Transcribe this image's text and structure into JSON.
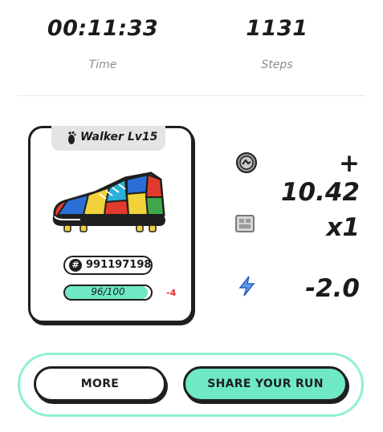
{
  "stats": {
    "time_value": "00:11:33",
    "time_label": "Time",
    "steps_value": "1131",
    "steps_label": "Steps"
  },
  "sneaker": {
    "badge_label": "Walker Lv15",
    "badge_icon": "footprint-icon",
    "id_value": "991197198",
    "durability_text": "96/100",
    "durability_fraction": 0.96,
    "durability_delta": "-4"
  },
  "rewards": {
    "earnings_value": "+ 10.42",
    "earnings_icon": "gst-coin-icon",
    "multiplier_value": "x1",
    "multiplier_icon": "realm-stamp-icon",
    "energy_value": "-2.0",
    "energy_icon": "energy-bolt-icon"
  },
  "actions": {
    "more_label": "MORE",
    "share_label": "SHARE YOUR RUN"
  },
  "colors": {
    "accent": "#6ee8c5",
    "outline": "#1f1f1f",
    "negative": "#e8292b",
    "muted": "#8e8e8e"
  }
}
